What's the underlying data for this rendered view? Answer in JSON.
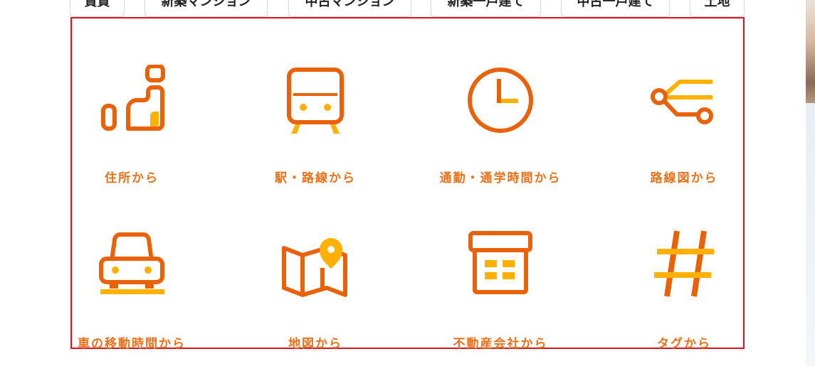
{
  "tabs": [
    {
      "label": "賃貸"
    },
    {
      "label": "新築マンション"
    },
    {
      "label": "中古マンション"
    },
    {
      "label": "新築一戸建て"
    },
    {
      "label": "中古一戸建て"
    },
    {
      "label": "土地"
    }
  ],
  "search_methods": [
    {
      "label": "住所から",
      "icon": "address-icon"
    },
    {
      "label": "駅・路線から",
      "icon": "train-icon"
    },
    {
      "label": "通勤・通学時間から",
      "icon": "clock-icon"
    },
    {
      "label": "路線図から",
      "icon": "route-map-icon"
    },
    {
      "label": "車の移動時間から",
      "icon": "car-icon"
    },
    {
      "label": "地図から",
      "icon": "map-pin-icon"
    },
    {
      "label": "不動産会社から",
      "icon": "office-building-icon"
    },
    {
      "label": "タグから",
      "icon": "hashtag-icon"
    }
  ],
  "colors": {
    "icon_primary": "#e8620a",
    "icon_accent": "#ffb000",
    "label": "#e8711b",
    "highlight_border": "#e01020"
  }
}
